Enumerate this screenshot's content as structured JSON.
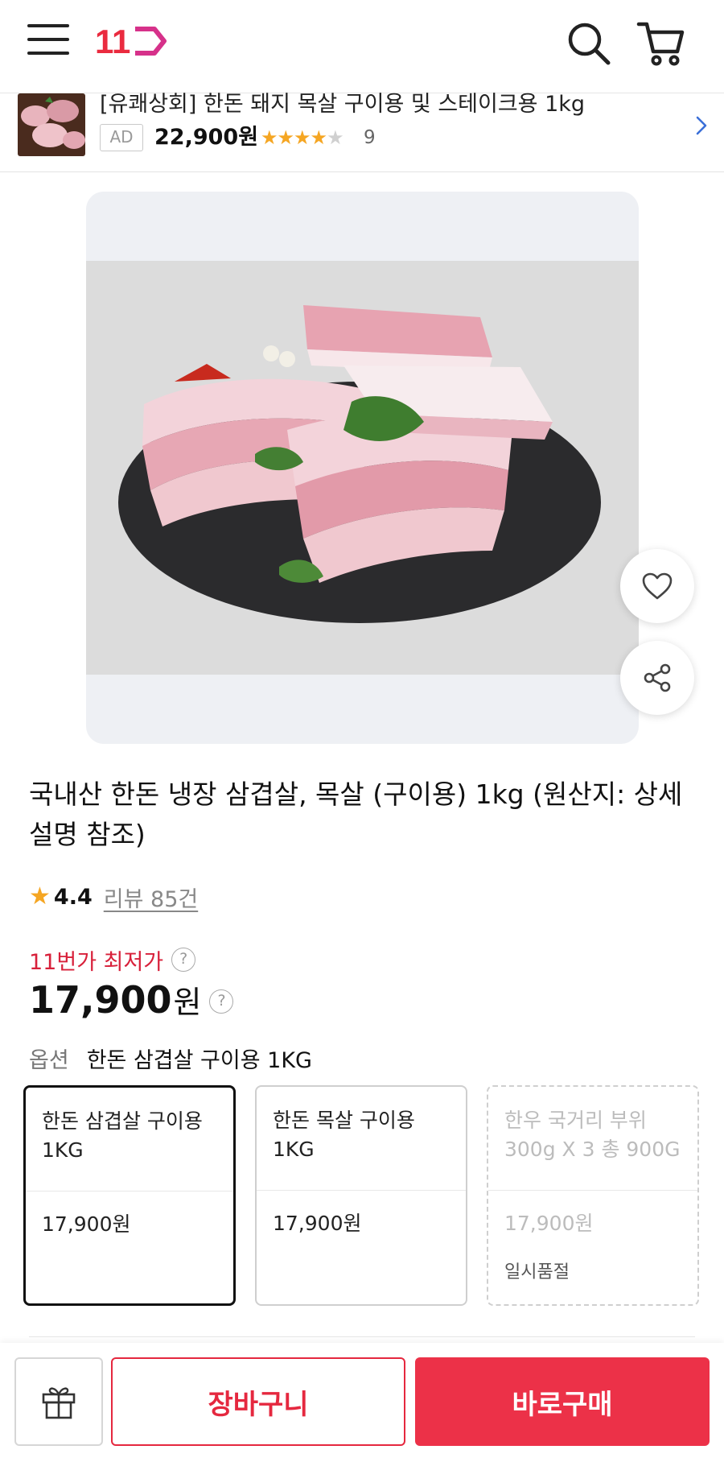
{
  "header": {
    "logo_text": "11"
  },
  "ad": {
    "title": "[유쾌상회] 한돈 돼지 목살 구이용 및 스테이크용 1kg",
    "badge": "AD",
    "price": "22,900원",
    "rating_stars": 4,
    "review_count": "9"
  },
  "product": {
    "title": "국내산 한돈 냉장 삼겹살, 목살 (구이용) 1kg (원산지: 상세설명 참조)",
    "rating": "4.4",
    "review_link": "리뷰 85건",
    "lowest_label": "11번가 최저가",
    "price": "17,900",
    "price_unit": "원",
    "option_label": "옵션",
    "option_value": "한돈 삼겹살 구이용 1KG"
  },
  "options": [
    {
      "name": "한돈 삼겹살 구이용 1KG",
      "price": "17,900원",
      "status": "",
      "state": "selected"
    },
    {
      "name": "한돈 목살 구이용 1KG",
      "price": "17,900원",
      "status": "",
      "state": "available"
    },
    {
      "name": "한우 국거리 부위 300g X 3 총 900G",
      "price": "17,900원",
      "status": "일시품절",
      "state": "soldout"
    }
  ],
  "bottom_bar": {
    "cart_label": "장바구니",
    "buy_label": "바로구매"
  },
  "icons": {
    "menu": "menu-icon",
    "search": "search-icon",
    "cart": "cart-icon",
    "heart": "heart-icon",
    "share": "share-icon",
    "gift": "gift-icon",
    "chevron": "chevron-right-icon"
  },
  "colors": {
    "accent": "#ec3148",
    "star": "#f5a623",
    "lowest_price": "#d8203a"
  }
}
